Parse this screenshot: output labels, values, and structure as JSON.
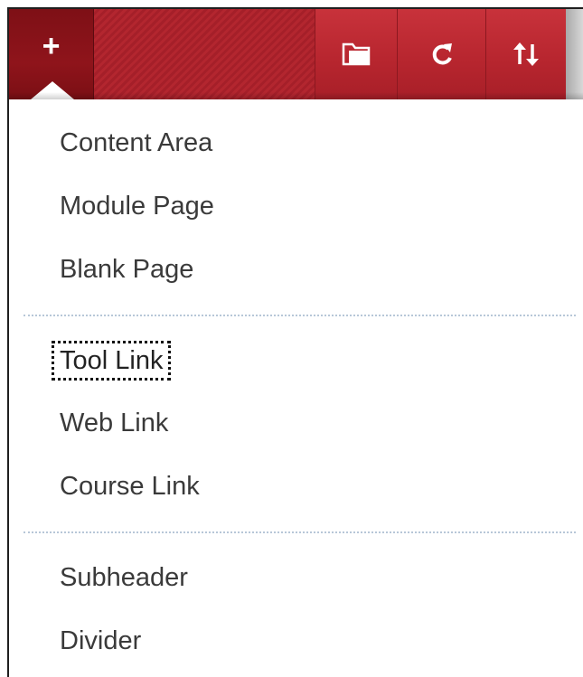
{
  "toolbar": {
    "add_button": {
      "icon": "plus-icon",
      "glyph": "+"
    },
    "buttons": [
      {
        "name": "create-folder-button",
        "icon": "folder-icon"
      },
      {
        "name": "refresh-button",
        "icon": "refresh-icon"
      },
      {
        "name": "reorder-button",
        "icon": "sort-arrows-icon"
      }
    ],
    "colors": {
      "primary": "#b3262f",
      "dark": "#7e1016"
    }
  },
  "menu": {
    "groups": [
      {
        "items": [
          "Content Area",
          "Module Page",
          "Blank Page"
        ]
      },
      {
        "items": [
          "Tool Link",
          "Web Link",
          "Course Link"
        ]
      },
      {
        "items": [
          "Subheader",
          "Divider"
        ]
      }
    ],
    "selected": "Tool Link"
  }
}
